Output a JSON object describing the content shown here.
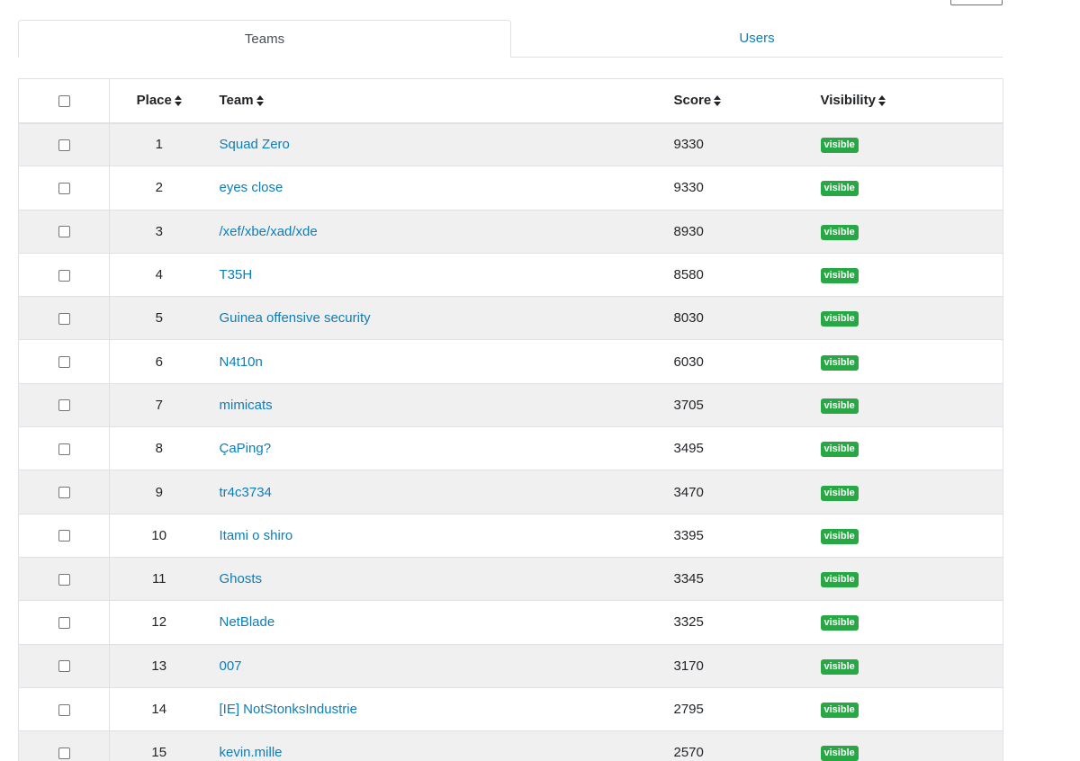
{
  "tabs": [
    {
      "label": "Teams",
      "active": true
    },
    {
      "label": "Users",
      "active": false
    }
  ],
  "table": {
    "headers": {
      "place": "Place",
      "team": "Team",
      "score": "Score",
      "visibility": "Visibility"
    },
    "rows": [
      {
        "place": "1",
        "team": "Squad Zero",
        "score": "9330",
        "visibility": "visible"
      },
      {
        "place": "2",
        "team": "eyes close",
        "score": "9330",
        "visibility": "visible"
      },
      {
        "place": "3",
        "team": "/xef/xbe/xad/xde",
        "score": "8930",
        "visibility": "visible"
      },
      {
        "place": "4",
        "team": "T35H",
        "score": "8580",
        "visibility": "visible"
      },
      {
        "place": "5",
        "team": "Guinea offensive security",
        "score": "8030",
        "visibility": "visible"
      },
      {
        "place": "6",
        "team": "N4t10n",
        "score": "6030",
        "visibility": "visible"
      },
      {
        "place": "7",
        "team": "mimicats",
        "score": "3705",
        "visibility": "visible"
      },
      {
        "place": "8",
        "team": "ÇaPing?",
        "score": "3495",
        "visibility": "visible"
      },
      {
        "place": "9",
        "team": "tr4c3734",
        "score": "3470",
        "visibility": "visible"
      },
      {
        "place": "10",
        "team": "Itami o shiro",
        "score": "3395",
        "visibility": "visible"
      },
      {
        "place": "11",
        "team": "Ghosts",
        "score": "3345",
        "visibility": "visible"
      },
      {
        "place": "12",
        "team": "NetBlade",
        "score": "3325",
        "visibility": "visible"
      },
      {
        "place": "13",
        "team": "007",
        "score": "3170",
        "visibility": "visible"
      },
      {
        "place": "14",
        "team": "[IE] NotStonksIndustrie",
        "score": "2795",
        "visibility": "visible"
      },
      {
        "place": "15",
        "team": "kevin.mille",
        "score": "2570",
        "visibility": "visible"
      }
    ]
  },
  "colors": {
    "link": "#0e7db8",
    "badge_visible": "#28a745",
    "row_stripe": "#f0f0f0"
  },
  "icons": {
    "sort": "sort-icon",
    "checkbox": "checkbox"
  }
}
